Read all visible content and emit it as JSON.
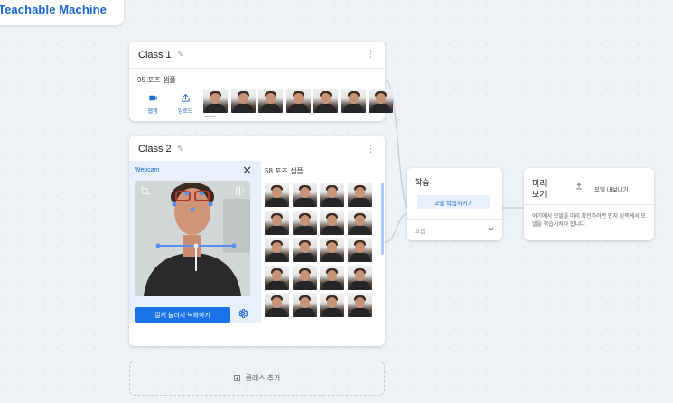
{
  "brand": {
    "title": "Teachable Machine"
  },
  "class1": {
    "title": "Class 1",
    "sample_count": "95 포즈 샘플",
    "webcam_label": "웹캠",
    "upload_label": "업로드"
  },
  "class2": {
    "title": "Class 2",
    "webcam_title": "Webcam",
    "sample_count": "58 포즈 샘플",
    "record_label": "길게 눌러서 녹화하기"
  },
  "training": {
    "title": "학습",
    "train_button": "모델 학습시키기",
    "advanced_label": "고급"
  },
  "preview": {
    "title": "미리보기",
    "export_label": "모델 내보내기",
    "message": "여기에서 모델을 미리 확인하려면 먼저 왼쪽에서 모델을 학습시켜야 합니다."
  },
  "add_class": {
    "label": "클래스 추가"
  },
  "colors": {
    "accent": "#1a73e8",
    "accent_light": "#e8f0fe",
    "brand": "#1967d2"
  },
  "icons": [
    "pencil-icon",
    "more-vert-icon",
    "video-camera-icon",
    "upload-icon",
    "close-icon",
    "crop-icon",
    "flip-icon",
    "settings-icon",
    "expand-more-icon",
    "share-icon",
    "add-box-icon"
  ]
}
